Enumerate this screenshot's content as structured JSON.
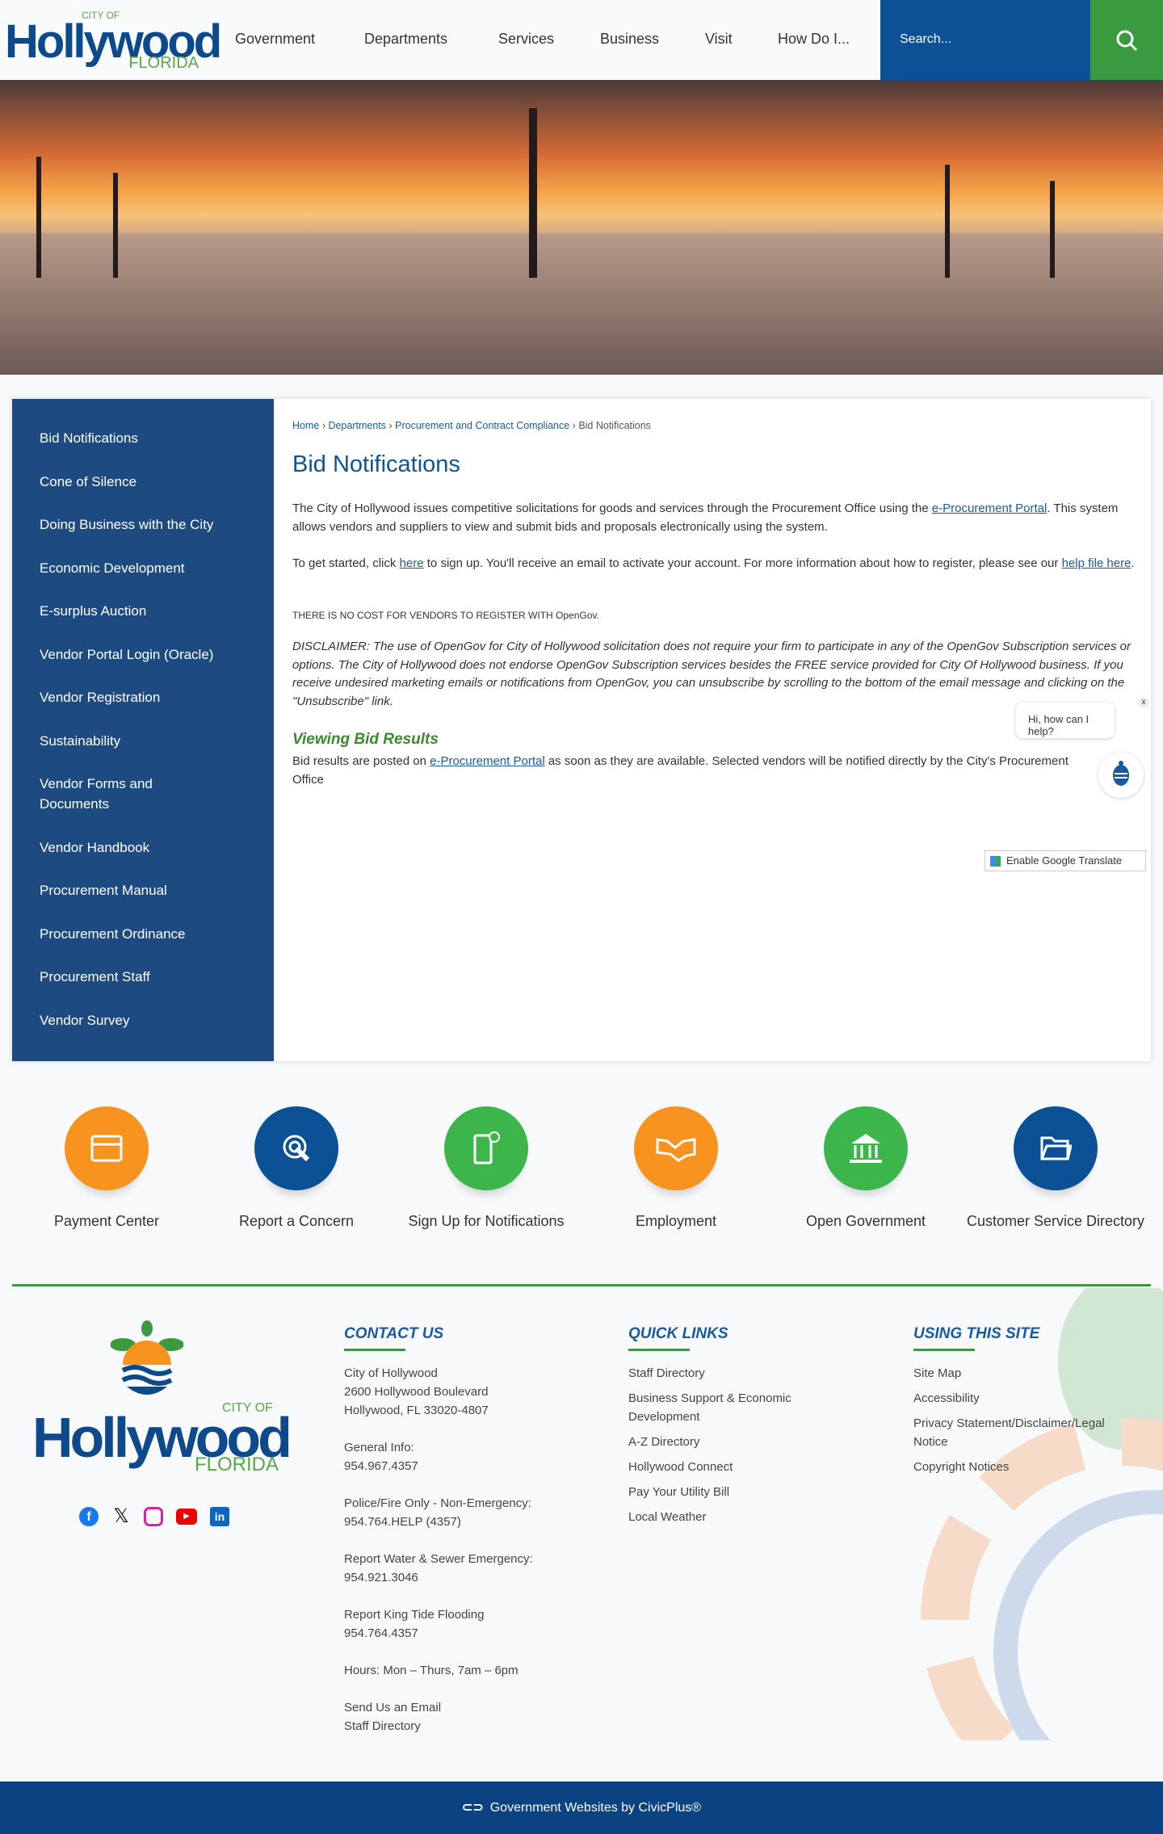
{
  "header": {
    "logo": {
      "city_of": "CITY OF",
      "name": "Hollywood",
      "state": "FLORIDA"
    },
    "nav": [
      "Government",
      "Departments",
      "Services",
      "Business",
      "Visit",
      "How Do I..."
    ],
    "search_placeholder": "Search..."
  },
  "sidebar": [
    "Bid Notifications",
    "Cone of Silence",
    "Doing Business with the City",
    "Economic Development",
    "E-surplus Auction",
    "Vendor Portal Login (Oracle)",
    "Vendor Registration",
    "Sustainability",
    "Vendor Forms and Documents",
    "Vendor Handbook",
    "Procurement Manual",
    "Procurement Ordinance",
    "Procurement Staff",
    "Vendor Survey"
  ],
  "breadcrumb": [
    "Home",
    "Departments",
    "Procurement and Contract Compliance",
    "Bid Notifications"
  ],
  "content": {
    "title": "Bid Notifications",
    "p1_a": "The City of Hollywood issues competitive solicitations for goods and services through the Procurement Office using the ",
    "p1_link": "e-Procurement Portal",
    "p1_b": ". This system allows vendors and suppliers to view and submit bids and proposals electronically using the system.",
    "p2_a": "To get started, click ",
    "p2_link1": "here",
    "p2_b": " to sign up. You'll receive an email to activate your account. For more information about how to register, please see our ",
    "p2_link2": "help file here",
    "p3": "THERE IS NO COST FOR VENDORS TO REGISTER WITH OpenGov.",
    "p4": "DISCLAIMER: The use of  OpenGov for City of Hollywood solicitation does not require your firm to participate in any of the OpenGov Subscription services or options. The City of Hollywood does not endorse OpenGov Subscription services besides the FREE service provided for City Of Hollywood business. If you receive undesired marketing emails or notifications from OpenGov, you can unsubscribe by scrolling to the bottom of the email message and clicking on the \"Unsubscribe\" link.",
    "h2": "Viewing Bid Results",
    "p5_a": "Bid results are posted on ",
    "p5_link": "e-Procurement Portal",
    "p5_b": "  as soon as they are available. Selected vendors will be notified directly by the City's Procurement Office"
  },
  "chat": {
    "bubble": "Hi, how can I help?",
    "close": "x"
  },
  "translate": "Enable Google Translate",
  "quick_links": [
    {
      "label": "Payment Center",
      "color": "#f7931e",
      "icon": "card-icon"
    },
    {
      "label": "Report a Concern",
      "color": "#0c5195",
      "icon": "touch-icon"
    },
    {
      "label": "Sign Up for Notifications",
      "color": "#3cb54a",
      "icon": "phone-alert-icon"
    },
    {
      "label": "Employment",
      "color": "#f7931e",
      "icon": "handshake-icon"
    },
    {
      "label": "Open Government",
      "color": "#3cb54a",
      "icon": "building-icon"
    },
    {
      "label": "Customer Service Directory",
      "color": "#0c5195",
      "icon": "folder-icon"
    }
  ],
  "footer": {
    "contact": {
      "heading": "CONTACT US",
      "lines": [
        "City of Hollywood",
        "2600 Hollywood Boulevard",
        "Hollywood, FL 33020-4807",
        "General Info:",
        "954.967.4357",
        "Police/Fire Only - Non-Emergency:",
        "954.764.HELP (4357)",
        "Report Water & Sewer Emergency:",
        "954.921.3046",
        "Report King Tide Flooding",
        "954.764.4357",
        "Hours: Mon – Thurs, 7am – 6pm",
        "Send Us an Email",
        "Staff Directory"
      ]
    },
    "quick": {
      "heading": "QUICK LINKS",
      "items": [
        "Staff Directory",
        "Business Support & Economic Development",
        "A-Z Directory",
        "Hollywood Connect",
        "Pay Your Utility Bill",
        "Local Weather"
      ]
    },
    "using": {
      "heading": "USING THIS SITE",
      "items": [
        "Site Map",
        "Accessibility",
        "Privacy Statement/Disclaimer/Legal Notice",
        "Copyright Notices"
      ]
    },
    "social": [
      "facebook-icon",
      "x-icon",
      "instagram-icon",
      "youtube-icon",
      "linkedin-icon"
    ],
    "credit": "Government Websites by CivicPlus®"
  }
}
